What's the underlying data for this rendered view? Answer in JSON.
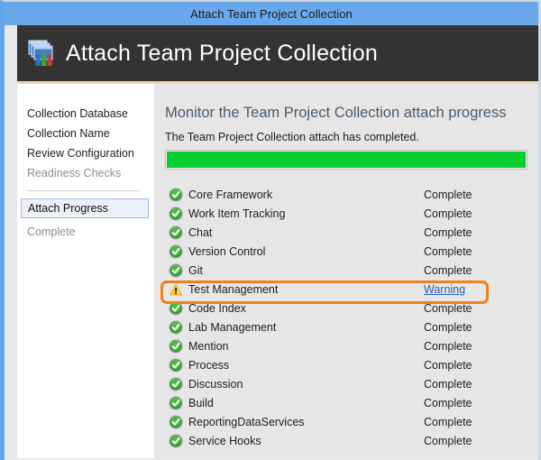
{
  "window": {
    "title": "Attach Team Project Collection",
    "accent_blue": "#6aa8ec",
    "banner_bg": "#333333",
    "accent_gold": "#e8d9a8"
  },
  "banner": {
    "title": "Attach Team Project Collection",
    "icon": "team-project-collection-icon"
  },
  "sidebar": {
    "items": [
      {
        "label": "Collection Database",
        "state": "done"
      },
      {
        "label": "Collection Name",
        "state": "done"
      },
      {
        "label": "Review Configuration",
        "state": "done"
      },
      {
        "label": "Readiness Checks",
        "state": "dim"
      },
      {
        "label": "Attach Progress",
        "state": "selected"
      },
      {
        "label": "Complete",
        "state": "dim"
      }
    ]
  },
  "main": {
    "heading": "Monitor the Team Project Collection attach progress",
    "subtext": "The Team Project Collection attach has completed.",
    "progress": {
      "percent": 100,
      "fill_color": "#06ce2c"
    },
    "status_labels": {
      "complete": "Complete",
      "warning": "Warning"
    },
    "tasks": [
      {
        "name": "Core Framework",
        "status": "Complete",
        "icon": "success-check-icon",
        "link": false
      },
      {
        "name": "Work Item Tracking",
        "status": "Complete",
        "icon": "success-check-icon",
        "link": false
      },
      {
        "name": "Chat",
        "status": "Complete",
        "icon": "success-check-icon",
        "link": false
      },
      {
        "name": "Version Control",
        "status": "Complete",
        "icon": "success-check-icon",
        "link": false
      },
      {
        "name": "Git",
        "status": "Complete",
        "icon": "success-check-icon",
        "link": false
      },
      {
        "name": "Test Management",
        "status": "Warning",
        "icon": "warning-triangle-icon",
        "link": true
      },
      {
        "name": "Code Index",
        "status": "Complete",
        "icon": "success-check-icon",
        "link": false
      },
      {
        "name": "Lab Management",
        "status": "Complete",
        "icon": "success-check-icon",
        "link": false
      },
      {
        "name": "Mention",
        "status": "Complete",
        "icon": "success-check-icon",
        "link": false
      },
      {
        "name": "Process",
        "status": "Complete",
        "icon": "success-check-icon",
        "link": false
      },
      {
        "name": "Discussion",
        "status": "Complete",
        "icon": "success-check-icon",
        "link": false
      },
      {
        "name": "Build",
        "status": "Complete",
        "icon": "success-check-icon",
        "link": false
      },
      {
        "name": "ReportingDataServices",
        "status": "Complete",
        "icon": "success-check-icon",
        "link": false
      },
      {
        "name": "Service Hooks",
        "status": "Complete",
        "icon": "success-check-icon",
        "link": false
      }
    ]
  },
  "annotation": {
    "type": "highlight-box",
    "color": "#f28019",
    "targets_task": "Test Management"
  }
}
